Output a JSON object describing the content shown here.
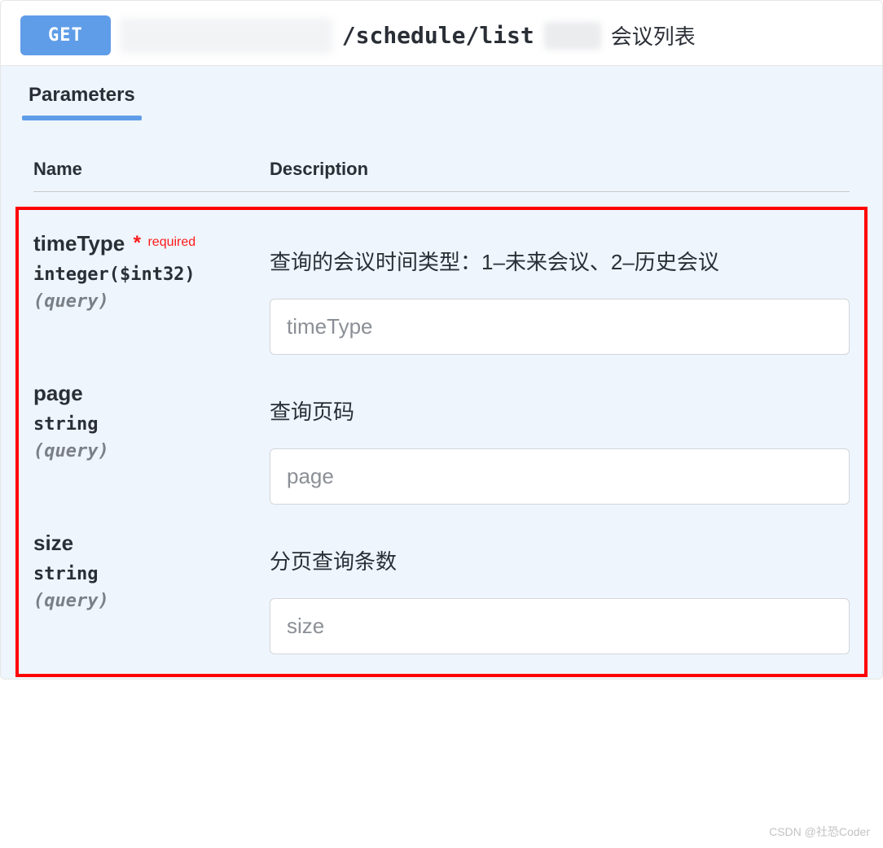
{
  "header": {
    "method": "GET",
    "path": "/schedule/list",
    "summary": "会议列表"
  },
  "tabs": {
    "parameters": "Parameters"
  },
  "columns": {
    "name": "Name",
    "description": "Description"
  },
  "required_label": "required",
  "params": [
    {
      "name": "timeType",
      "required": true,
      "type": "integer($int32)",
      "in": "(query)",
      "description": "查询的会议时间类型：1–未来会议、2–历史会议",
      "placeholder": "timeType"
    },
    {
      "name": "page",
      "required": false,
      "type": "string",
      "in": "(query)",
      "description": "查询页码",
      "placeholder": "page"
    },
    {
      "name": "size",
      "required": false,
      "type": "string",
      "in": "(query)",
      "description": "分页查询条数",
      "placeholder": "size"
    }
  ],
  "watermark": "CSDN @社恐Coder"
}
